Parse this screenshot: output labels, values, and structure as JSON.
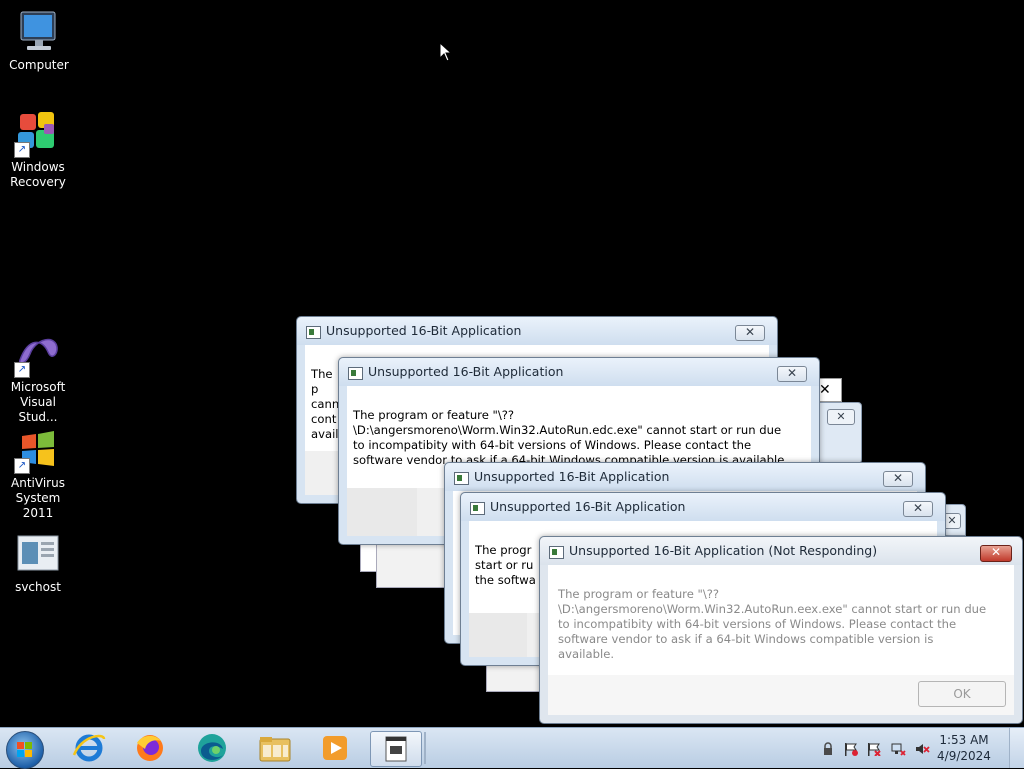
{
  "desktop": {
    "icons": [
      {
        "label": "Computer",
        "icon": "computer-icon"
      },
      {
        "label": "Windows Recovery",
        "icon": "puzzle-icon"
      },
      {
        "label": "Microsoft Visual Stud...",
        "icon": "visual-studio-icon"
      },
      {
        "label": "AntiVirus System 2011",
        "icon": "windows-flag-icon"
      },
      {
        "label": "svchost",
        "icon": "document-icon"
      }
    ]
  },
  "dialogs": [
    {
      "title": "Unsupported 16-Bit Application",
      "partial_text": "The p\ncann\ncont\navail"
    },
    {
      "title": "Unsupported 16-Bit Application",
      "message": "The program or feature \"\\??\\D:\\angersmoreno\\Worm.Win32.AutoRun.edc.exe\" cannot start or run due to incompatibity with 64-bit versions of Windows. Please contact the software vendor to ask if a 64-bit Windows compatible version is available."
    },
    {
      "title": "Unsupported 16-Bit Application"
    },
    {
      "title": "Unsupported 16-Bit Application",
      "partial_text": "The progr\nstart or ru\nthe softwa"
    },
    {
      "title": "Unsupported 16-Bit Application (Not Responding)",
      "message": "The program or feature \"\\??\\D:\\angersmoreno\\Worm.Win32.AutoRun.eex.exe\" cannot start or run due to incompatibity with 64-bit versions of Windows. Please contact the software vendor to ask if a 64-bit Windows compatible version is available.",
      "ok_label": "OK"
    }
  ],
  "taskbar": {
    "pinned": [
      "internet-explorer-icon",
      "firefox-icon",
      "edge-icon",
      "file-explorer-icon",
      "media-player-icon",
      "app-icon"
    ],
    "tray_icons": [
      "security-icon",
      "action-center-flag-icon",
      "action-center-flag-error-icon",
      "network-icon",
      "volume-muted-icon"
    ],
    "clock": {
      "time": "1:53 AM",
      "date": "4/9/2024"
    }
  },
  "colors": {
    "desktop": "#000000",
    "taskbar": "#c9d9ea",
    "titlebar": "#dce8f5",
    "close_red": "#c0392b"
  }
}
